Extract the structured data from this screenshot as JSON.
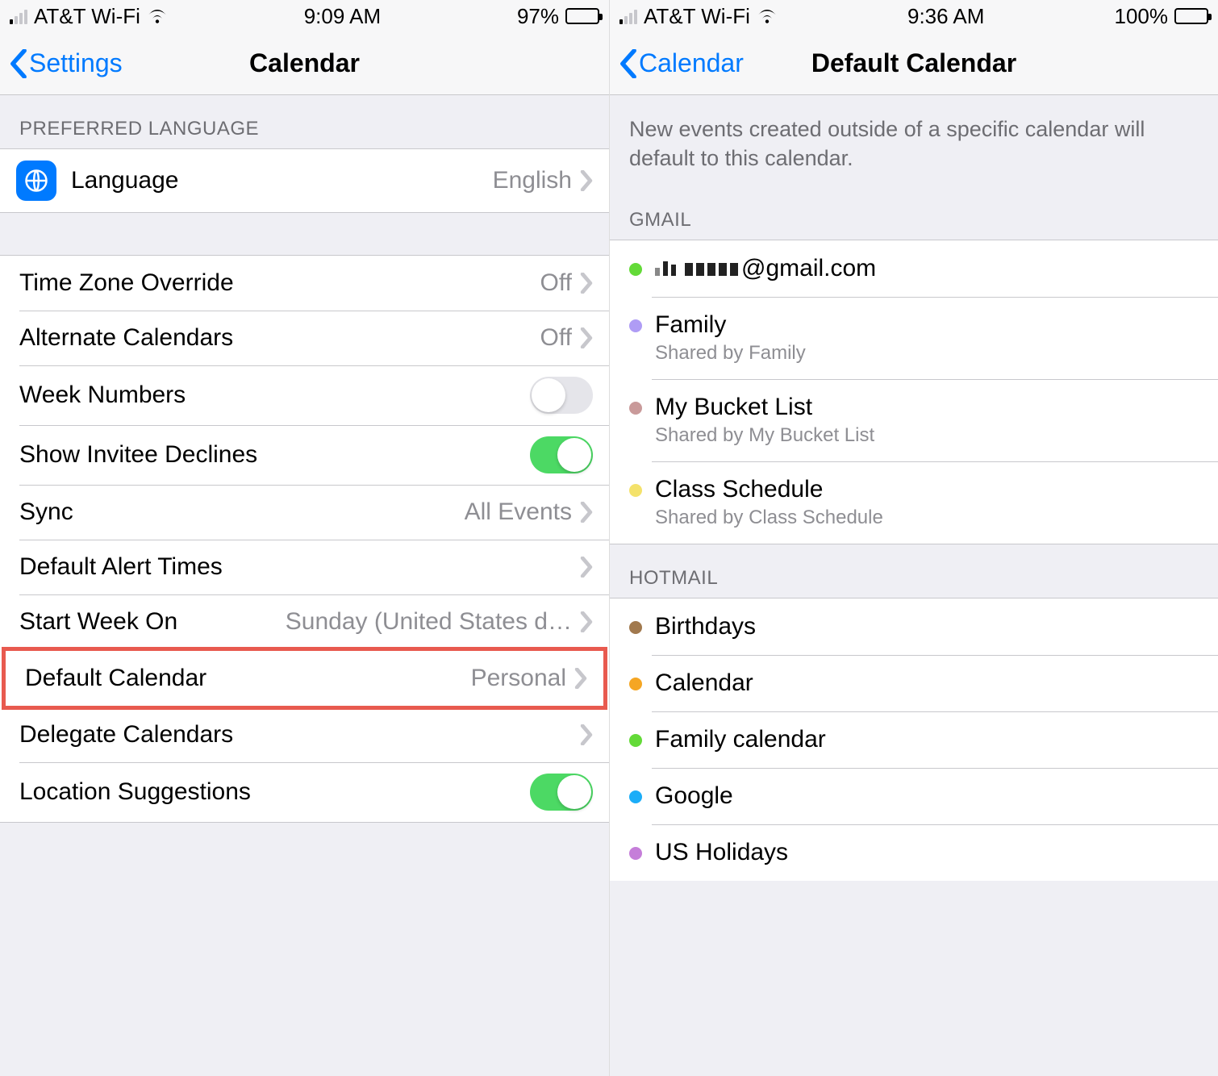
{
  "left": {
    "status": {
      "carrier": "AT&T Wi-Fi",
      "time": "9:09 AM",
      "battery_pct": "97%",
      "battery_fill": 97
    },
    "nav": {
      "back": "Settings",
      "title": "Calendar"
    },
    "lang_header": "PREFERRED LANGUAGE",
    "language": {
      "label": "Language",
      "value": "English"
    },
    "rows": {
      "timezone": {
        "label": "Time Zone Override",
        "value": "Off"
      },
      "alt": {
        "label": "Alternate Calendars",
        "value": "Off"
      },
      "weeknum": {
        "label": "Week Numbers",
        "on": false
      },
      "declines": {
        "label": "Show Invitee Declines",
        "on": true
      },
      "sync": {
        "label": "Sync",
        "value": "All Events"
      },
      "alerts": {
        "label": "Default Alert Times"
      },
      "startweek": {
        "label": "Start Week On",
        "value": "Sunday (United States d…"
      },
      "defcal": {
        "label": "Default Calendar",
        "value": "Personal"
      },
      "delegate": {
        "label": "Delegate Calendars"
      },
      "location": {
        "label": "Location Suggestions",
        "on": true
      }
    }
  },
  "right": {
    "status": {
      "carrier": "AT&T Wi-Fi",
      "time": "9:36 AM",
      "battery_pct": "100%",
      "battery_fill": 100
    },
    "nav": {
      "back": "Calendar",
      "title": "Default Calendar"
    },
    "description": "New events created outside of a specific calendar will default to this calendar.",
    "sections": {
      "gmail": {
        "header": "GMAIL",
        "items": [
          {
            "color": "#63da38",
            "label_suffix": "@gmail.com",
            "redacted": true
          },
          {
            "color": "#af9cf5",
            "label": "Family",
            "sub": "Shared by Family"
          },
          {
            "color": "#c99a9a",
            "label": "My Bucket List",
            "sub": "Shared by My Bucket List"
          },
          {
            "color": "#f4e26b",
            "label": "Class Schedule",
            "sub": "Shared by Class Schedule"
          }
        ]
      },
      "hotmail": {
        "header": "HOTMAIL",
        "items": [
          {
            "color": "#a1794e",
            "label": "Birthdays"
          },
          {
            "color": "#f5a623",
            "label": "Calendar"
          },
          {
            "color": "#63da38",
            "label": "Family calendar"
          },
          {
            "color": "#1badf8",
            "label": "Google"
          },
          {
            "color": "#c57ed9",
            "label": "US Holidays"
          }
        ]
      }
    }
  }
}
